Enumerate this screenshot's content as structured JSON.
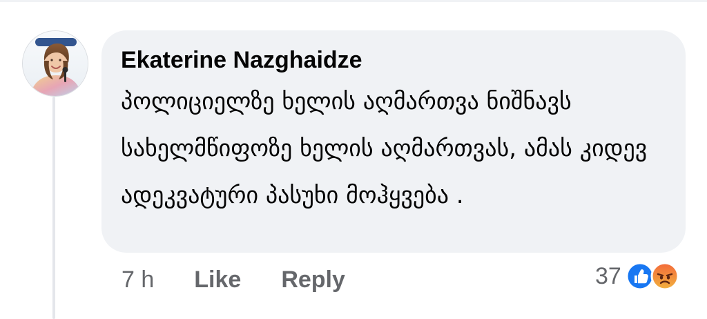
{
  "comment": {
    "author_name": "Ekaterine Nazghaidze",
    "text": "პოლიციელზე ხელის აღმართვა ნიშნავს სახელმწიფოზე ხელის აღმართვას, ამას კიდევ ადეკვატური პასუხი მოჰყვება ."
  },
  "actions": {
    "timestamp": "7 h",
    "like_label": "Like",
    "reply_label": "Reply"
  },
  "reactions": {
    "count": "37",
    "icons": [
      "like-reaction-icon",
      "angry-reaction-icon"
    ]
  },
  "colors": {
    "bubble_bg": "#f0f2f5",
    "meta_text": "#65676b",
    "like_blue": "#1877f2",
    "angry_orange": "#f5653b"
  }
}
